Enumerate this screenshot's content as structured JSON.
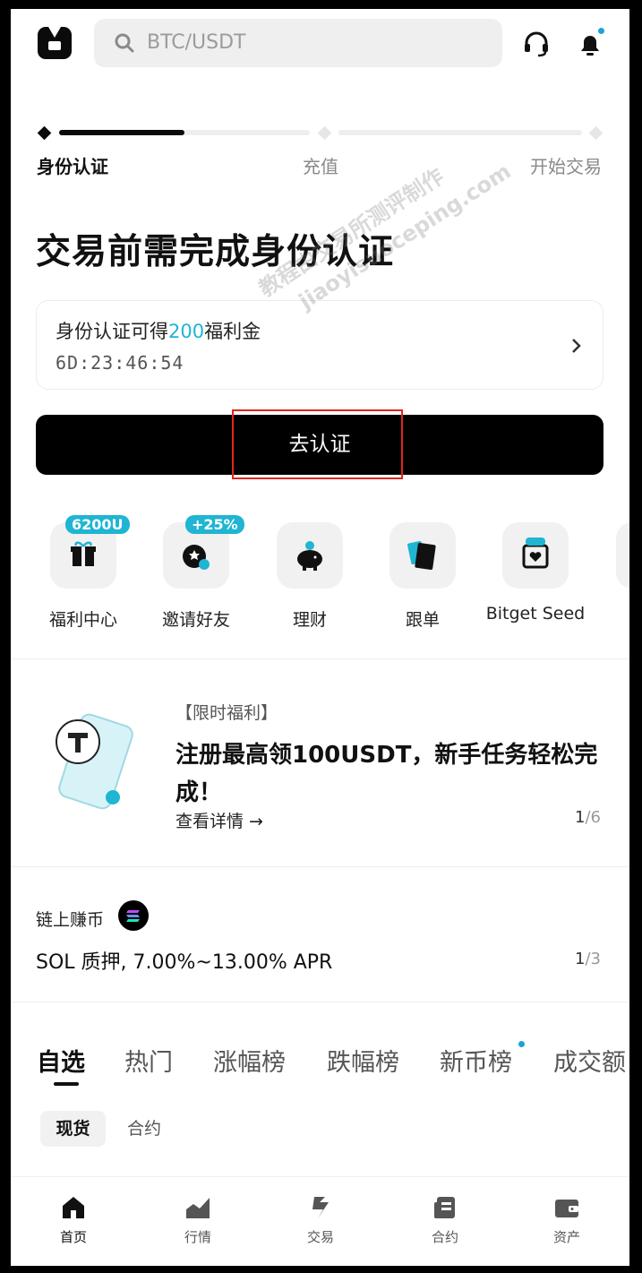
{
  "header": {
    "search_placeholder": "BTC/USDT"
  },
  "kyc": {
    "steps": [
      "身份认证",
      "充值",
      "开始交易"
    ],
    "title": "交易前需完成身份认证",
    "reward_prefix": "身份认证可得",
    "reward_amount": "200",
    "reward_suffix": "福利金",
    "countdown": "6D:23:46:54",
    "cta": "去认证"
  },
  "quick_links": [
    {
      "label": "福利中心",
      "badge": "6200U",
      "icon": "gift-icon"
    },
    {
      "label": "邀请好友",
      "badge": "+25%",
      "icon": "invite-icon"
    },
    {
      "label": "理财",
      "icon": "piggy-bank-icon"
    },
    {
      "label": "跟单",
      "icon": "copy-trade-icon"
    },
    {
      "label": "Bitget Seed",
      "icon": "meme-icon"
    }
  ],
  "promo": {
    "tag": "【限时福利】",
    "title": "注册最高领100USDT，新手任务轻松完成！",
    "link": "查看详情 →",
    "pager_current": "1",
    "pager_total": "/6"
  },
  "chain": {
    "label": "链上赚币",
    "text": "SOL 质押, 7.00%~13.00% APR",
    "pager_current": "1",
    "pager_total": "/3"
  },
  "market_tabs": [
    "自选",
    "热门",
    "涨幅榜",
    "跌幅榜",
    "新币榜",
    "成交额"
  ],
  "segments": [
    "现货",
    "合约"
  ],
  "bottom_nav": [
    "首页",
    "行情",
    "交易",
    "合约",
    "资产"
  ],
  "watermark": [
    "教程由交易所测评制作",
    "jiaoyisuoceping.com"
  ],
  "colors": {
    "accent": "#1fb5d3",
    "primary": "#000000",
    "highlight_box": "#e2251e"
  }
}
